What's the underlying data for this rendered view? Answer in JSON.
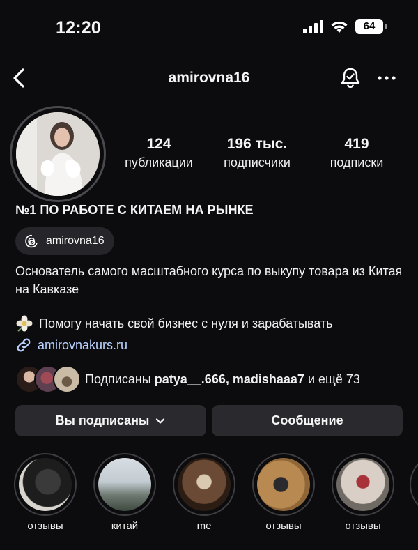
{
  "status_bar": {
    "time": "12:20",
    "battery": "64"
  },
  "header": {
    "username": "amirovna16"
  },
  "stats": [
    {
      "value": "124",
      "label": "публикации"
    },
    {
      "value": "196 тыс.",
      "label": "подписчики"
    },
    {
      "value": "419",
      "label": "подписки"
    }
  ],
  "profile": {
    "name": "№1 ПО РАБОТЕ С КИТАЕМ НА РЫНКЕ",
    "threads_handle": "amirovna16",
    "bio_line1": "Основатель самого масштабного курса по выкупу товара из Китая на Кавказе",
    "bio_line2": "Помогу начать свой бизнес с нуля и зарабатывать",
    "link": "amirovnakurs.ru"
  },
  "followed_by": {
    "prefix": "Подписаны",
    "user1": "patya__.666",
    "separator": ",",
    "user2": "madishaaa7",
    "suffix": "и ещё 73"
  },
  "buttons": {
    "follow": "Вы подписаны",
    "message": "Сообщение"
  },
  "highlights": [
    {
      "label": "отзывы"
    },
    {
      "label": "китай"
    },
    {
      "label": "me"
    },
    {
      "label": "отзывы"
    },
    {
      "label": "отзывы"
    }
  ],
  "colors": {
    "background": "#0c0c0e",
    "button_bg": "#2a2a2e",
    "link": "#b9d2ff"
  },
  "icons": [
    "back-arrow-icon",
    "notification-bell-icon",
    "more-options-icon",
    "threads-icon",
    "flower-icon",
    "link-icon",
    "chevron-down-icon"
  ]
}
